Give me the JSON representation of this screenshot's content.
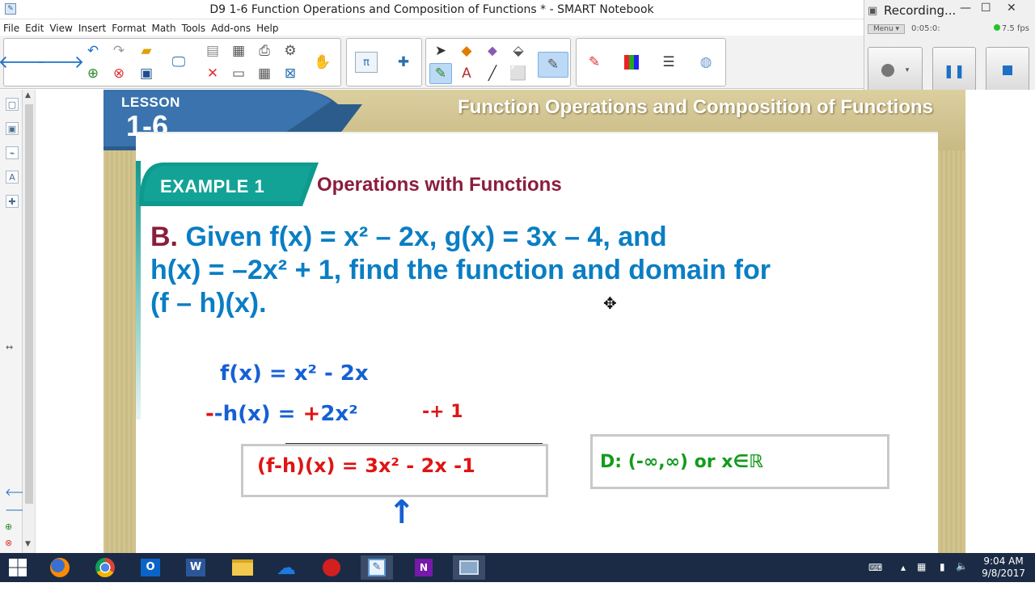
{
  "window": {
    "title": "D9 1-6 Function Operations and Composition of Functions * - SMART Notebook"
  },
  "menu": [
    "File",
    "Edit",
    "View",
    "Insert",
    "Format",
    "Math",
    "Tools",
    "Add-ons",
    "Help"
  ],
  "recording": {
    "title": "Recording...",
    "menu_label": "Menu ▾",
    "timer": "0:05:0:",
    "fps": "7.5 fps"
  },
  "slide": {
    "lesson_label": "LESSON",
    "lesson_number": "1-6",
    "title": "Function Operations and Composition of Functions",
    "example_label": "EXAMPLE 1",
    "example_title": "Operations with Functions",
    "question_letter": "B.",
    "question_text_1": " Given f(x) = x² – 2x, g(x) = 3x – 4, and",
    "question_text_2": "h(x) = –2x² + 1, find the function and domain for",
    "question_text_3": "(f – h)(x)."
  },
  "handwriting": {
    "line1": "f(x) = x² - 2x",
    "line2_prefix": "-h(x) = ",
    "line2_red_plus": "+",
    "line2_term": "2x²",
    "line2_red_tail": "-+ 1",
    "result": "(f-h)(x) = 3x² - 2x -1",
    "domain": "D: (-∞,∞)   or   x∈ℝ",
    "up_arrow": "↑"
  },
  "taskbar": {
    "time": "9:04 AM",
    "date": "9/8/2017"
  }
}
